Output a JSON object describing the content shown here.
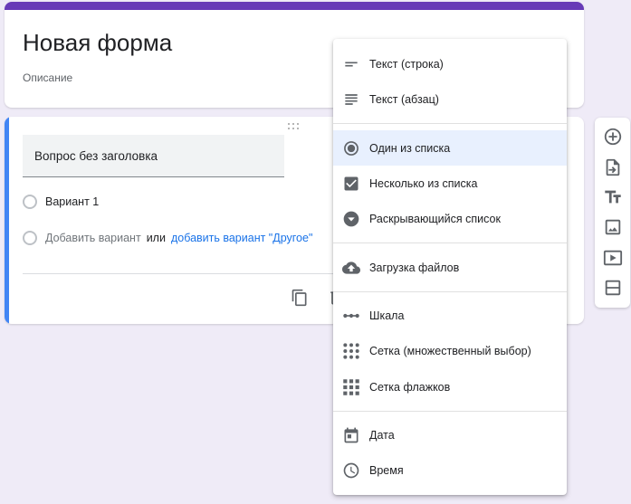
{
  "form": {
    "title": "Новая форма",
    "description_placeholder": "Описание",
    "accent_color": "#673ab7"
  },
  "question": {
    "title_placeholder": "Вопрос без заголовка",
    "option1": "Вариант 1",
    "add_option": "Добавить вариант",
    "or": "или",
    "add_other": "добавить вариант \"Другое\"",
    "accent_color": "#4285f4"
  },
  "menu": {
    "items": [
      {
        "label": "Текст (строка)",
        "icon": "short-text-icon"
      },
      {
        "label": "Текст (абзац)",
        "icon": "paragraph-icon"
      },
      {
        "label": "Один из списка",
        "icon": "radio-button-icon",
        "selected": true
      },
      {
        "label": "Несколько из списка",
        "icon": "checkbox-icon"
      },
      {
        "label": "Раскрывающийся список",
        "icon": "dropdown-icon"
      },
      {
        "label": "Загрузка файлов",
        "icon": "cloud-upload-icon"
      },
      {
        "label": "Шкала",
        "icon": "linear-scale-icon"
      },
      {
        "label": "Сетка (множественный выбор)",
        "icon": "grid-dots-icon"
      },
      {
        "label": "Сетка флажков",
        "icon": "grid-squares-icon"
      },
      {
        "label": "Дата",
        "icon": "calendar-icon"
      },
      {
        "label": "Время",
        "icon": "clock-icon"
      }
    ]
  },
  "toolbar": {
    "items": [
      "add-question-icon",
      "import-questions-icon",
      "add-title-icon",
      "add-image-icon",
      "add-video-icon",
      "add-section-icon"
    ]
  }
}
